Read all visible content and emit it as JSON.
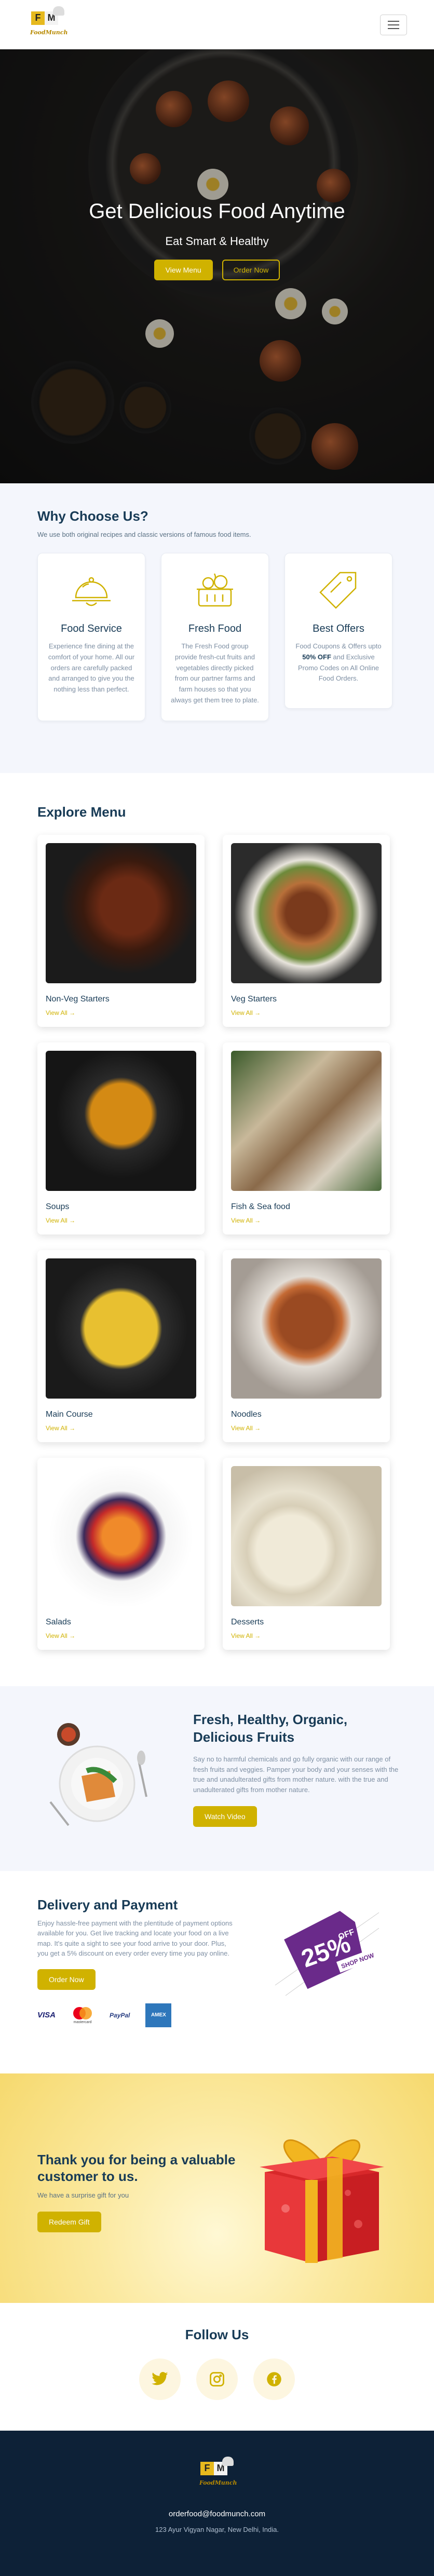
{
  "brand": {
    "logo_letters": [
      "F",
      "M"
    ],
    "logo_text": "FoodMunch"
  },
  "nav": {
    "menu_icon": "hamburger-icon"
  },
  "hero": {
    "title": "Get Delicious Food Anytime",
    "subtitle": "Eat Smart & Healthy",
    "primary_btn": "View Menu",
    "secondary_btn": "Order Now"
  },
  "why": {
    "title": "Why Choose Us?",
    "desc": "We use both original recipes and classic versions of famous food items.",
    "cards": [
      {
        "icon": "cloche-icon",
        "title": "Food Service",
        "text": "Experience fine dining at the comfort of your home. All our orders are carefully packed and arranged to give you the nothing less than perfect."
      },
      {
        "icon": "grocery-basket-icon",
        "title": "Fresh Food",
        "text": "The Fresh Food group provide fresh-cut fruits and vegetables directly picked from our partner farms and farm houses so that you always get them tree to plate."
      },
      {
        "icon": "price-tag-icon",
        "title": "Best Offers",
        "text_pre": "Food Coupons & Offers upto ",
        "text_bold": "50% OFF",
        "text_post": " and Exclusive Promo Codes on All Online Food Orders."
      }
    ]
  },
  "explore": {
    "title": "Explore Menu",
    "view_all": "View All",
    "items": [
      {
        "name": "Non-Veg Starters"
      },
      {
        "name": "Veg Starters"
      },
      {
        "name": "Soups"
      },
      {
        "name": "Fish & Sea food"
      },
      {
        "name": "Main Course"
      },
      {
        "name": "Noodles"
      },
      {
        "name": "Salads"
      },
      {
        "name": "Desserts"
      }
    ]
  },
  "fresh": {
    "title": "Fresh, Healthy, Organic, Delicious Fruits",
    "text": "Say no to harmful chemicals and go fully organic with our range of fresh fruits and veggies. Pamper your body and your senses with the true and unadulterated gifts from mother nature. with the true and unadulterated gifts from mother nature.",
    "btn": "Watch Video"
  },
  "delivery": {
    "title": "Delivery and Payment",
    "text": "Enjoy hassle-free payment with the plentitude of payment options available for you. Get live tracking and locate your food on a live map. It's quite a sight to see your food arrive to your door. Plus, you get a 5% discount on every order every time you pay online.",
    "btn": "Order Now",
    "payments": [
      "VISA",
      "mastercard",
      "PayPal",
      "AMEX"
    ],
    "offer_big": "25%",
    "offer_small": "OFF",
    "offer_tag": "SHOP NOW"
  },
  "thanks": {
    "title": "Thank you for being a valuable customer to us.",
    "text": "We have a surprise gift for you",
    "btn": "Redeem Gift"
  },
  "follow": {
    "title": "Follow Us",
    "icons": [
      "twitter-icon",
      "instagram-icon",
      "facebook-icon"
    ]
  },
  "footer": {
    "email": "orderfood@foodmunch.com",
    "address": "123 Ayur Vigyan Nagar, New Delhi, India."
  },
  "colors": {
    "accent": "#d0b200",
    "heading": "#183b56",
    "footer_bg": "#0d2137",
    "section_bg": "#f4f6fc"
  }
}
